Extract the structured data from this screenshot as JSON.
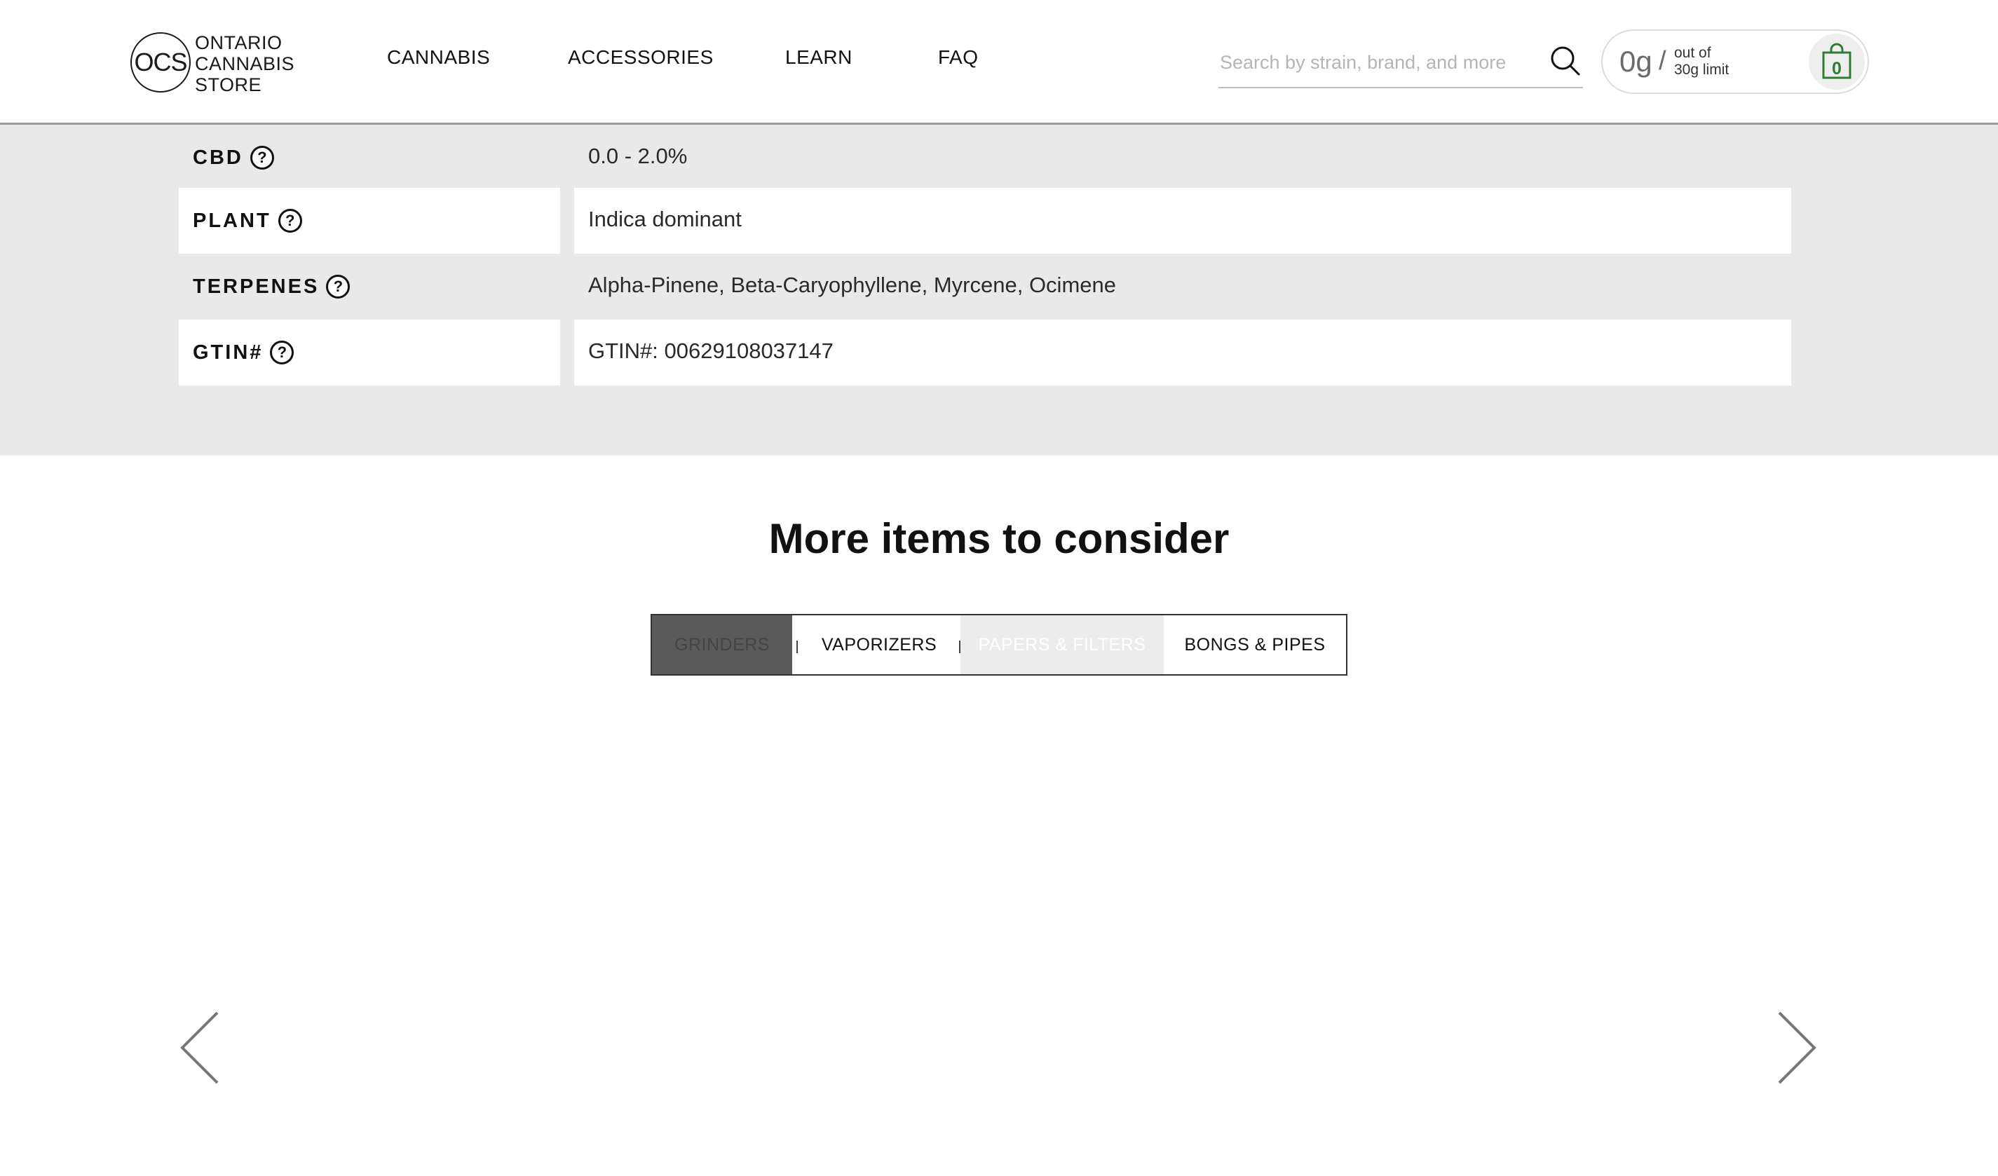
{
  "header": {
    "logo": {
      "mark": "OCS",
      "lines": [
        "ONTARIO",
        "CANNABIS",
        "STORE"
      ]
    },
    "nav": [
      "CANNABIS",
      "ACCESSORIES",
      "LEARN",
      "FAQ"
    ],
    "search": {
      "placeholder": "Search by strain, brand, and more",
      "value": ""
    },
    "limit": {
      "grams": "0g",
      "slash": "/",
      "line1": "out of",
      "line2": "30g limit"
    },
    "cart": {
      "count": "0"
    }
  },
  "details": {
    "rows": [
      {
        "label": "CBD",
        "value": "0.0 - 2.0%"
      },
      {
        "label": "PLANT",
        "value": "Indica dominant"
      },
      {
        "label": "TERPENES",
        "value": "Alpha-Pinene, Beta-Caryophyllene, Myrcene, Ocimene"
      },
      {
        "label": "GTIN#",
        "value": "GTIN#: 00629108037147"
      }
    ],
    "help_symbol": "?"
  },
  "more_items": {
    "title": "More items to consider",
    "tabs": [
      "GRINDERS",
      "VAPORIZERS",
      "PAPERS & FILTERS",
      "BONGS & PIPES"
    ],
    "active_tab": "GRINDERS"
  },
  "colors": {
    "cart_accent": "#2e7d32",
    "details_background": "#e9e9e9",
    "active_tab": "#5a5a5a"
  },
  "icons": {
    "search": "search-icon",
    "cart": "shopping-bag-icon",
    "prev": "chevron-left-icon",
    "next": "chevron-right-icon",
    "help": "help-circle-icon"
  }
}
